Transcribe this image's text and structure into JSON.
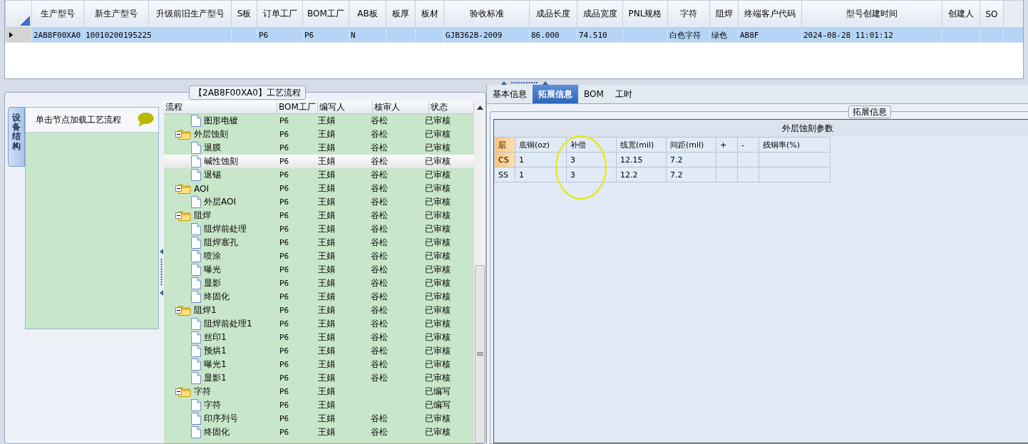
{
  "model_grid": {
    "columns": [
      "生产型号",
      "新生产型号",
      "升级前旧生产型号",
      "S板",
      "订单工厂",
      "BOM工厂",
      "AB板",
      "板厚",
      "板材",
      "验收标准",
      "成品长度",
      "成品宽度",
      "PNL规格",
      "字符",
      "阻焊",
      "终端客户代码",
      "型号创建时间",
      "创建人",
      "SO"
    ],
    "rows": [
      {
        "selected": true,
        "cells": [
          "2AB8F00XA0",
          "10010200195225",
          "",
          "",
          "P6",
          "P6",
          "N",
          "",
          "",
          "GJB362B-2009",
          "86.000",
          "74.510",
          "",
          "白色字符",
          "绿色",
          "AB8F",
          "2024-08-28 11:01:12",
          "",
          ""
        ]
      }
    ]
  },
  "process_panel": {
    "title": "【2AB8F00XA0】工艺流程",
    "side_tab": "设备结构",
    "side_header": "单击节点加载工艺流程",
    "tree": {
      "columns": [
        "流程",
        "BOM工厂",
        "编写人",
        "核审人",
        "状态"
      ],
      "rows": [
        {
          "kind": "file",
          "label": "图形电镀",
          "bom": "P6",
          "writer": "王娟",
          "reviewer": "谷松",
          "status": "已审核",
          "selected": false
        },
        {
          "kind": "folder",
          "label": "外层蚀刻",
          "bom": "P6",
          "writer": "王娟",
          "reviewer": "谷松",
          "status": "已审核",
          "selected": false,
          "expanded": true,
          "children": [
            {
              "kind": "file",
              "label": "退膜",
              "bom": "P6",
              "writer": "王娟",
              "reviewer": "谷松",
              "status": "已审核",
              "selected": false
            },
            {
              "kind": "file",
              "label": "碱性蚀刻",
              "bom": "P6",
              "writer": "王娟",
              "reviewer": "谷松",
              "status": "已审核",
              "selected": true
            },
            {
              "kind": "file",
              "label": "退锡",
              "bom": "P6",
              "writer": "王娟",
              "reviewer": "谷松",
              "status": "已审核",
              "selected": false
            }
          ]
        },
        {
          "kind": "folder",
          "label": "AOI",
          "bom": "P6",
          "writer": "王娟",
          "reviewer": "谷松",
          "status": "已审核",
          "selected": false,
          "expanded": true,
          "children": [
            {
              "kind": "file",
              "label": "外层AOI",
              "bom": "P6",
              "writer": "王娟",
              "reviewer": "谷松",
              "status": "已审核",
              "selected": false
            }
          ]
        },
        {
          "kind": "folder",
          "label": "阻焊",
          "bom": "P6",
          "writer": "王娟",
          "reviewer": "谷松",
          "status": "已审核",
          "selected": false,
          "expanded": true,
          "children": [
            {
              "kind": "file",
              "label": "阻焊前处理",
              "bom": "P6",
              "writer": "王娟",
              "reviewer": "谷松",
              "status": "已审核",
              "selected": false
            },
            {
              "kind": "file",
              "label": "阻焊塞孔",
              "bom": "P6",
              "writer": "王娟",
              "reviewer": "谷松",
              "status": "已审核",
              "selected": false
            },
            {
              "kind": "file",
              "label": "喷涂",
              "bom": "P6",
              "writer": "王娟",
              "reviewer": "谷松",
              "status": "已审核",
              "selected": false
            },
            {
              "kind": "file",
              "label": "曝光",
              "bom": "P6",
              "writer": "王娟",
              "reviewer": "谷松",
              "status": "已审核",
              "selected": false
            },
            {
              "kind": "file",
              "label": "显影",
              "bom": "P6",
              "writer": "王娟",
              "reviewer": "谷松",
              "status": "已审核",
              "selected": false
            },
            {
              "kind": "file",
              "label": "终固化",
              "bom": "P6",
              "writer": "王娟",
              "reviewer": "谷松",
              "status": "已审核",
              "selected": false
            }
          ]
        },
        {
          "kind": "folder",
          "label": "阻焊1",
          "bom": "P6",
          "writer": "王娟",
          "reviewer": "谷松",
          "status": "已审核",
          "selected": false,
          "expanded": true,
          "children": [
            {
              "kind": "file",
              "label": "阻焊前处理1",
              "bom": "P6",
              "writer": "王娟",
              "reviewer": "谷松",
              "status": "已审核",
              "selected": false
            },
            {
              "kind": "file",
              "label": "丝印1",
              "bom": "P6",
              "writer": "王娟",
              "reviewer": "谷松",
              "status": "已审核",
              "selected": false
            },
            {
              "kind": "file",
              "label": "预烘1",
              "bom": "P6",
              "writer": "王娟",
              "reviewer": "谷松",
              "status": "已审核",
              "selected": false
            },
            {
              "kind": "file",
              "label": "曝光1",
              "bom": "P6",
              "writer": "王娟",
              "reviewer": "谷松",
              "status": "已审核",
              "selected": false
            },
            {
              "kind": "file",
              "label": "显影1",
              "bom": "P6",
              "writer": "王娟",
              "reviewer": "谷松",
              "status": "已审核",
              "selected": false
            }
          ]
        },
        {
          "kind": "folder",
          "label": "字符",
          "bom": "P6",
          "writer": "王娟",
          "status": "已编写",
          "selected": false,
          "expanded": true,
          "children": [
            {
              "kind": "file",
              "label": "字符",
              "bom": "P6",
              "writer": "王娟",
              "status": "已编写",
              "selected": false
            },
            {
              "kind": "file",
              "label": "印序列号",
              "bom": "P6",
              "writer": "王娟",
              "reviewer": "谷松",
              "status": "已审核",
              "selected": false
            },
            {
              "kind": "file",
              "label": "终固化",
              "bom": "P6",
              "writer": "王娟",
              "reviewer": "谷松",
              "status": "已审核",
              "selected": false
            }
          ]
        }
      ]
    }
  },
  "detail_panel": {
    "tabs": [
      {
        "label": "基本信息",
        "selected": false
      },
      {
        "label": "拓展信息",
        "selected": true
      },
      {
        "label": "BOM",
        "selected": false
      },
      {
        "label": "工时",
        "selected": false
      }
    ],
    "group_title": "拓展信息",
    "table_caption": "外层蚀刻参数",
    "table": {
      "columns": [
        "层",
        "底铜(oz)",
        "补偿",
        "线宽(mil)",
        "间距(mil)",
        "+",
        "-",
        "残铜率(%)"
      ],
      "rows": [
        {
          "selected": true,
          "cells": [
            "CS",
            "1",
            "3",
            "12.15",
            "7.2",
            "",
            "",
            ""
          ]
        },
        {
          "selected": false,
          "cells": [
            "SS",
            "1",
            "3",
            "12.2",
            "7.2",
            "",
            "",
            ""
          ]
        }
      ]
    }
  }
}
